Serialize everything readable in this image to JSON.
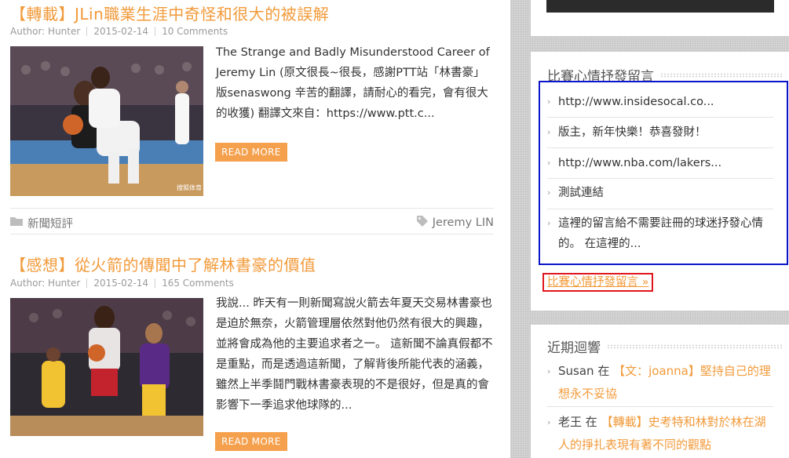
{
  "posts": [
    {
      "title": "【轉載】JLin職業生涯中奇怪和很大的被誤解",
      "author": "Author: Hunter",
      "date": "2015-02-14",
      "comments": "10 Comments",
      "excerpt": "The Strange and Badly Misunderstood Career of Jeremy Lin (原文很長~很長，感謝PTT站「林書豪」版senaswong 辛苦的翻譯，請耐心的看完，會有很大的收獲) 翻譯文來自：https://www.ptt.c...",
      "read_more": "READ MORE",
      "category": "新聞短評",
      "tag": "Jeremy LIN"
    },
    {
      "title": "【感想】從火箭的傳聞中了解林書豪的價值",
      "author": "Author: Hunter",
      "date": "2015-02-14",
      "comments": "165 Comments",
      "excerpt": "我說... 昨天有一則新聞寫說火箭去年夏天交易林書豪也是迫於無奈，火箭管理層依然對他仍然有很大的興趣，並將會成為他的主要追求者之一。 這新聞不論真假都不是重點，而是透過這新聞，了解背後所能代表的涵義，雖然上半季鬪門戰林書豪表現的不是很好，但是真的會影響下一季追求他球隊的...",
      "read_more": "READ MORE"
    }
  ],
  "widgets": {
    "comments_widget": {
      "title": "比賽心情抒發留言",
      "items": [
        "http://www.insidesocal.co...",
        "版主，新年快樂！恭喜發財！",
        "http://www.nba.com/lakers...",
        "測試連結",
        "這裡的留言給不需要註冊的球迷抒發心情的。 在這裡的..."
      ],
      "more_link": "比賽心情抒發留言 »"
    },
    "recent": {
      "title": "近期迴響",
      "items": [
        {
          "who": "Susan",
          "in": " 在 ",
          "post": "【文：joanna】堅持自己的理想永不妥協"
        },
        {
          "who": "老王",
          "in": " 在 ",
          "post": "【轉載】史考特和林對於林在湖人的掙扎表現有著不同的觀點"
        }
      ]
    }
  },
  "colors": {
    "accent": "#f29a3a",
    "highlight_blue": "#0b16c8",
    "highlight_red": "#e0141c"
  },
  "icons": [
    "folder-icon",
    "tag-icon",
    "chevron-right-icon"
  ]
}
